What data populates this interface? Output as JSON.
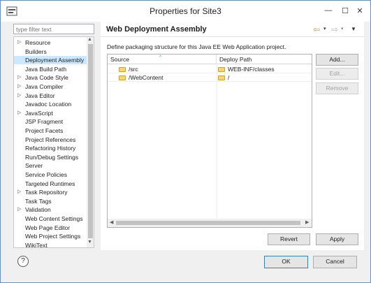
{
  "window": {
    "title": "Properties for Site3",
    "minimize_glyph": "—",
    "maximize_glyph": "☐",
    "close_glyph": "✕"
  },
  "filter": {
    "placeholder": "type filter text",
    "value": ""
  },
  "tree": {
    "items": [
      {
        "label": "Resource",
        "twisty": "▷",
        "selected": false
      },
      {
        "label": "Builders",
        "twisty": "",
        "selected": false
      },
      {
        "label": "Deployment Assembly",
        "twisty": "",
        "selected": true
      },
      {
        "label": "Java Build Path",
        "twisty": "",
        "selected": false
      },
      {
        "label": "Java Code Style",
        "twisty": "▷",
        "selected": false
      },
      {
        "label": "Java Compiler",
        "twisty": "▷",
        "selected": false
      },
      {
        "label": "Java Editor",
        "twisty": "▷",
        "selected": false
      },
      {
        "label": "Javadoc Location",
        "twisty": "",
        "selected": false
      },
      {
        "label": "JavaScript",
        "twisty": "▷",
        "selected": false
      },
      {
        "label": "JSP Fragment",
        "twisty": "",
        "selected": false
      },
      {
        "label": "Project Facets",
        "twisty": "",
        "selected": false
      },
      {
        "label": "Project References",
        "twisty": "",
        "selected": false
      },
      {
        "label": "Refactoring History",
        "twisty": "",
        "selected": false
      },
      {
        "label": "Run/Debug Settings",
        "twisty": "",
        "selected": false
      },
      {
        "label": "Server",
        "twisty": "",
        "selected": false
      },
      {
        "label": "Service Policies",
        "twisty": "",
        "selected": false
      },
      {
        "label": "Targeted Runtimes",
        "twisty": "",
        "selected": false
      },
      {
        "label": "Task Repository",
        "twisty": "▷",
        "selected": false
      },
      {
        "label": "Task Tags",
        "twisty": "",
        "selected": false
      },
      {
        "label": "Validation",
        "twisty": "▷",
        "selected": false
      },
      {
        "label": "Web Content Settings",
        "twisty": "",
        "selected": false
      },
      {
        "label": "Web Page Editor",
        "twisty": "",
        "selected": false
      },
      {
        "label": "Web Project Settings",
        "twisty": "",
        "selected": false
      },
      {
        "label": "WikiText",
        "twisty": "",
        "selected": false
      }
    ],
    "scroll_up_glyph": "▲",
    "scroll_down_glyph": "▼"
  },
  "page": {
    "heading": "Web Deployment Assembly",
    "description": "Define packaging structure for this Java EE Web Application project.",
    "nav": {
      "back_glyph": "⇦",
      "forward_glyph": "⇨",
      "dropdown_glyph": "▾",
      "menu_glyph": "▼"
    }
  },
  "table": {
    "columns": [
      "Source",
      "Deploy Path"
    ],
    "sort_glyph": "^",
    "rows": [
      {
        "source": "/src",
        "deploy": "WEB-INF/classes"
      },
      {
        "source": "/WebContent",
        "deploy": "/"
      }
    ],
    "scroll_left_glyph": "◀",
    "scroll_right_glyph": "▶"
  },
  "buttons": {
    "add": "Add...",
    "edit": "Edit...",
    "remove": "Remove",
    "revert": "Revert",
    "apply": "Apply",
    "ok": "OK",
    "cancel": "Cancel",
    "help": "?"
  },
  "colors": {
    "selection": "#cce8ff",
    "folder": "#f3d675",
    "back_arrow": "#d9a300"
  }
}
